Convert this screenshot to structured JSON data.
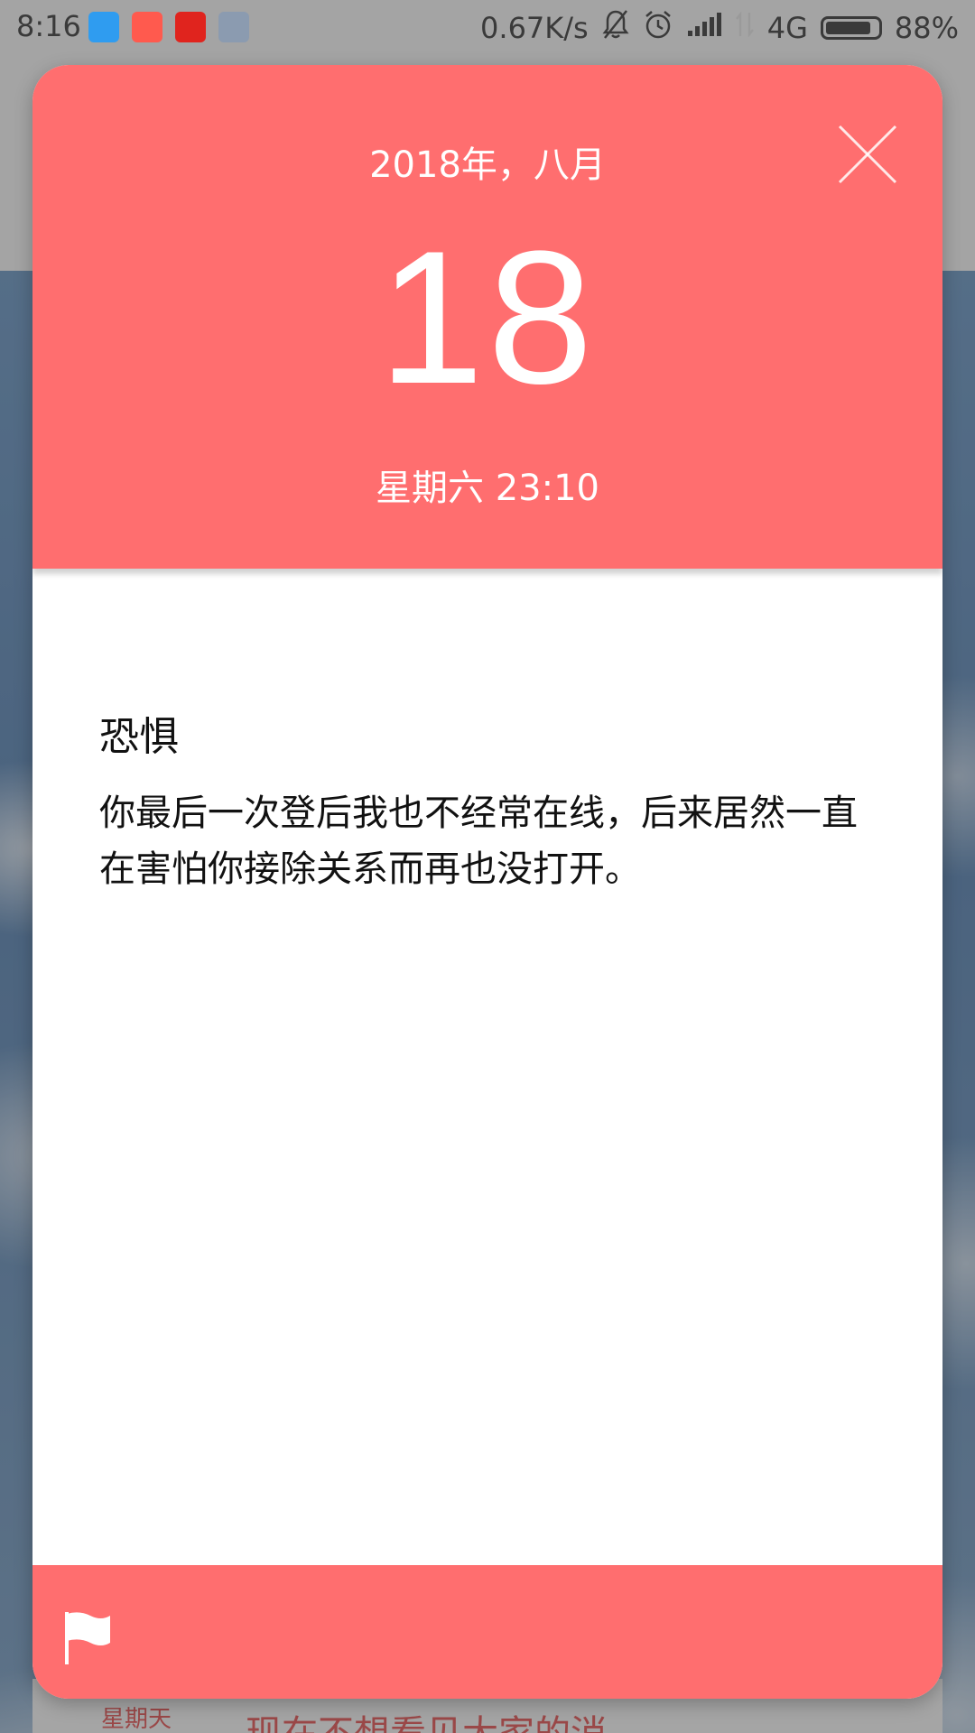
{
  "status_bar": {
    "time": "8:16",
    "net_speed": "0.67K/s",
    "network": "4G",
    "battery": "88%"
  },
  "background": {
    "day_label": "星期天",
    "message_preview": "现在不想看见大家的消"
  },
  "card": {
    "year_month": "2018年，八月",
    "day": "18",
    "weekday_time": "星期六 23:10",
    "title": "恐惧",
    "body": "你最后一次登后我也不经常在线，后来居然一直在害怕你接除关系而再也没打开。"
  },
  "colors": {
    "accent": "#ff6e6f",
    "text": "#111111"
  },
  "icons": {
    "close": "close-icon",
    "flag": "flag-icon",
    "mute": "bell-off-icon",
    "alarm": "alarm-icon",
    "signal": "signal-icon",
    "data": "data-transfer-icon",
    "battery": "battery-icon"
  }
}
